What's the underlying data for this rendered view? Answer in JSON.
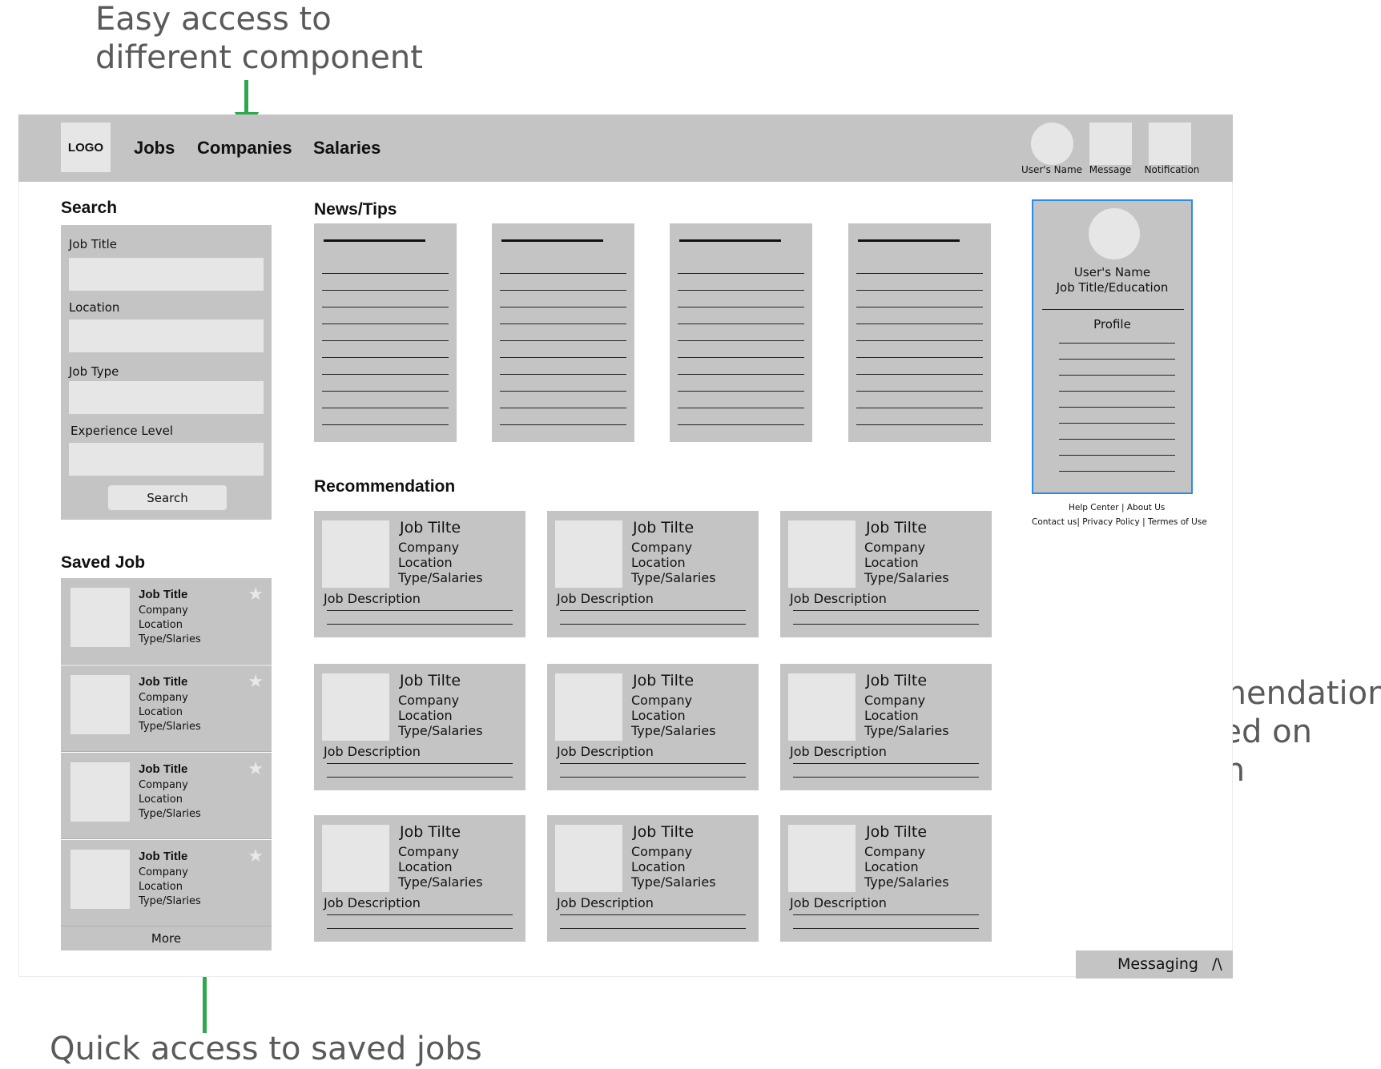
{
  "annotations": {
    "top_line1": "Easy access to",
    "top_line2": "different component",
    "right_line1": "Recommendation",
    "right_line2": "job based on past",
    "right_line3": "research",
    "bottom": "Quick access to saved jobs",
    "arrow_color": "#2ea84f"
  },
  "header": {
    "logo": "LOGO",
    "nav": [
      "Jobs",
      "Companies",
      "Salaries"
    ],
    "user_label": "User's Name",
    "message_label": "Message",
    "notification_label": "Notification"
  },
  "search": {
    "title": "Search",
    "fields": [
      "Job Title",
      "Location",
      "Job Type",
      "Experience Level"
    ],
    "button": "Search"
  },
  "saved_jobs": {
    "title": "Saved Job",
    "items": [
      {
        "title": "Job Title",
        "company": "Company",
        "location": "Location",
        "type": "Type/Slaries"
      },
      {
        "title": "Job Title",
        "company": "Company",
        "location": "Location",
        "type": "Type/Slaries"
      },
      {
        "title": "Job Title",
        "company": "Company",
        "location": "Location",
        "type": "Type/Slaries"
      },
      {
        "title": "Job Title",
        "company": "Company",
        "location": "Location",
        "type": "Type/Slaries"
      }
    ],
    "more": "More"
  },
  "news": {
    "title": "News/Tips",
    "cards": 4
  },
  "recommendation": {
    "title": "Recommendation",
    "cards": [
      {
        "title": "Job Tilte",
        "company": "Company",
        "location": "Location",
        "type": "Type/Salaries",
        "desc": "Job Description"
      },
      {
        "title": "Job Tilte",
        "company": "Company",
        "location": "Location",
        "type": "Type/Salaries",
        "desc": "Job Description"
      },
      {
        "title": "Job Tilte",
        "company": "Company",
        "location": "Location",
        "type": "Type/Salaries",
        "desc": "Job Description"
      },
      {
        "title": "Job Tilte",
        "company": "Company",
        "location": "Location",
        "type": "Type/Salaries",
        "desc": "Job Description"
      },
      {
        "title": "Job Tilte",
        "company": "Company",
        "location": "Location",
        "type": "Type/Salaries",
        "desc": "Job Description"
      },
      {
        "title": "Job Tilte",
        "company": "Company",
        "location": "Location",
        "type": "Type/Salaries",
        "desc": "Job Description"
      },
      {
        "title": "Job Tilte",
        "company": "Company",
        "location": "Location",
        "type": "Type/Salaries",
        "desc": "Job Description"
      },
      {
        "title": "Job Tilte",
        "company": "Company",
        "location": "Location",
        "type": "Type/Salaries",
        "desc": "Job Description"
      },
      {
        "title": "Job Tilte",
        "company": "Company",
        "location": "Location",
        "type": "Type/Salaries",
        "desc": "Job Description"
      }
    ]
  },
  "profile": {
    "name": "User's Name",
    "subtitle": "Job Title/Education",
    "section": "Profile"
  },
  "footer": {
    "help": "Help Center",
    "about": "About Us",
    "contact": "Contact us",
    "privacy": "Privacy Policy",
    "terms": "Termes of Use"
  },
  "messaging": {
    "label": "Messaging",
    "toggle": "/\\"
  }
}
